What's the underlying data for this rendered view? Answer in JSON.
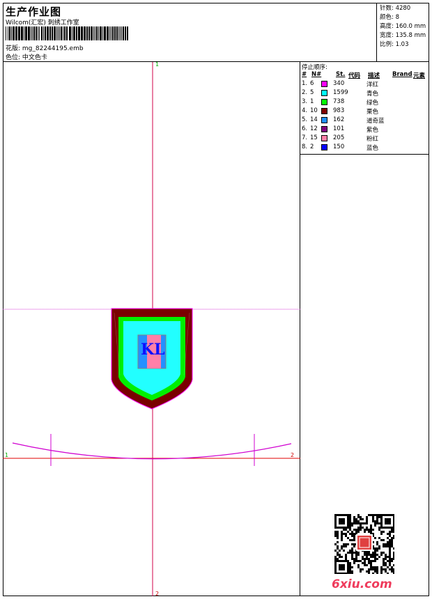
{
  "header": {
    "title": "生产作业图",
    "subtitle": "Wilcom(汇宏) 刺绣工作室",
    "file": "花版: mg_82244195.emb",
    "colorcard": "色位: 中文色卡"
  },
  "info": {
    "stitches": "针数: 4280",
    "colors": "颜色: 8",
    "height": "高度: 160.0 mm",
    "width": "宽度: 135.8 mm",
    "ratio": "比例: 1.03"
  },
  "panel": {
    "heading": "停止顺序:",
    "columns": [
      "#",
      "N#",
      "St.",
      "代码",
      "描述",
      "Brand",
      "元素"
    ],
    "rows": [
      {
        "idx": "1.",
        "n": "6",
        "st": "340",
        "desc": "洋红",
        "color": "#ff00ff"
      },
      {
        "idx": "2.",
        "n": "5",
        "st": "1599",
        "desc": "青色",
        "color": "#00ffff"
      },
      {
        "idx": "3.",
        "n": "1",
        "st": "738",
        "desc": "绿色",
        "color": "#00ff00"
      },
      {
        "idx": "4.",
        "n": "10",
        "st": "983",
        "desc": "栗色",
        "color": "#800000"
      },
      {
        "idx": "5.",
        "n": "14",
        "st": "162",
        "desc": "道奇蓝",
        "color": "#1e90ff"
      },
      {
        "idx": "6.",
        "n": "12",
        "st": "101",
        "desc": "紫色",
        "color": "#800080"
      },
      {
        "idx": "7.",
        "n": "15",
        "st": "205",
        "desc": "粉红",
        "color": "#ff7fa8"
      },
      {
        "idx": "8.",
        "n": "2",
        "st": "150",
        "desc": "蓝色",
        "color": "#0000ff"
      }
    ]
  },
  "canvas": {
    "top_mark": "1",
    "bottom_mark": "2",
    "left_mark": "1",
    "right_mark": "2",
    "design_text": "KL"
  },
  "watermark": "6xiu.com"
}
